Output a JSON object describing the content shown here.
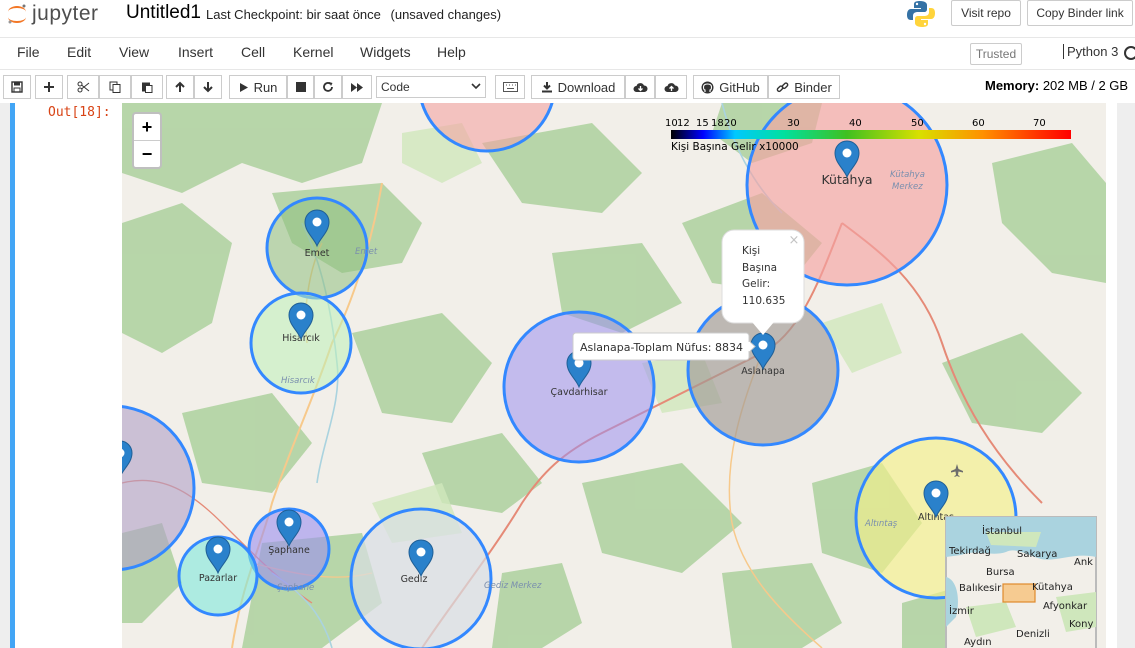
{
  "header": {
    "logo_text": "jupyter",
    "notebook_title": "Untitled1",
    "checkpoint": "Last Checkpoint: bir saat önce",
    "unsaved": "(unsaved changes)",
    "visit_repo": "Visit repo",
    "copy_binder": "Copy Binder link"
  },
  "menu": {
    "items": [
      "File",
      "Edit",
      "View",
      "Insert",
      "Cell",
      "Kernel",
      "Widgets",
      "Help"
    ],
    "trusted": "Trusted",
    "kernel": "Python 3"
  },
  "toolbar": {
    "run": "Run",
    "cell_type": "Code",
    "download": "Download",
    "github": "GitHub",
    "binder": "Binder",
    "memory_label": "Memory:",
    "memory_value": "202 MB / 2 GB"
  },
  "cell": {
    "prompt": "Out[18]:"
  },
  "map": {
    "zoom_in": "+",
    "zoom_out": "−",
    "legend": {
      "ticks": [
        "10",
        "12",
        "15",
        "18",
        "20",
        "30",
        "40",
        "50",
        "60",
        "70"
      ],
      "caption": "Kişi Başına Gelir x10000"
    },
    "popup": {
      "lines": [
        "Kişi",
        "Başına",
        "Gelir:",
        "110.635"
      ],
      "close": "×"
    },
    "tooltip": "Aslanapa-Toplam Nüfus: 8834",
    "places": [
      {
        "name": "Emet",
        "fill": "#8fbf7f"
      },
      {
        "name": "Hisarcık",
        "fill": "#bdf0b8"
      },
      {
        "name": "Çavdarhisar",
        "fill": "#9c8ff0"
      },
      {
        "name": "Aslanapa",
        "fill": "#a09a96"
      },
      {
        "name": "Kütahya",
        "fill": "#f4a3a3"
      },
      {
        "name": "Altıntaş",
        "fill": "#f3f08a"
      },
      {
        "name": "Gediz",
        "fill": "#d8dee4"
      },
      {
        "name": "Şaphane",
        "fill": "#9b8df0"
      },
      {
        "name": "Pazarlar",
        "fill": "#7fe8dc"
      }
    ],
    "road_labels": [
      "Emet",
      "Hisarcık",
      "Kütahya Merkez",
      "Altıntaş",
      "Gediz Merkez",
      "Şaphane"
    ],
    "minimap": [
      "İstanbul",
      "Tekirdağ",
      "Sakarya",
      "Ank",
      "Bursa",
      "Balıkesir",
      "Kütahya",
      "İzmir",
      "Afyonkar",
      "Kony",
      "Aydın",
      "Denizli"
    ]
  }
}
